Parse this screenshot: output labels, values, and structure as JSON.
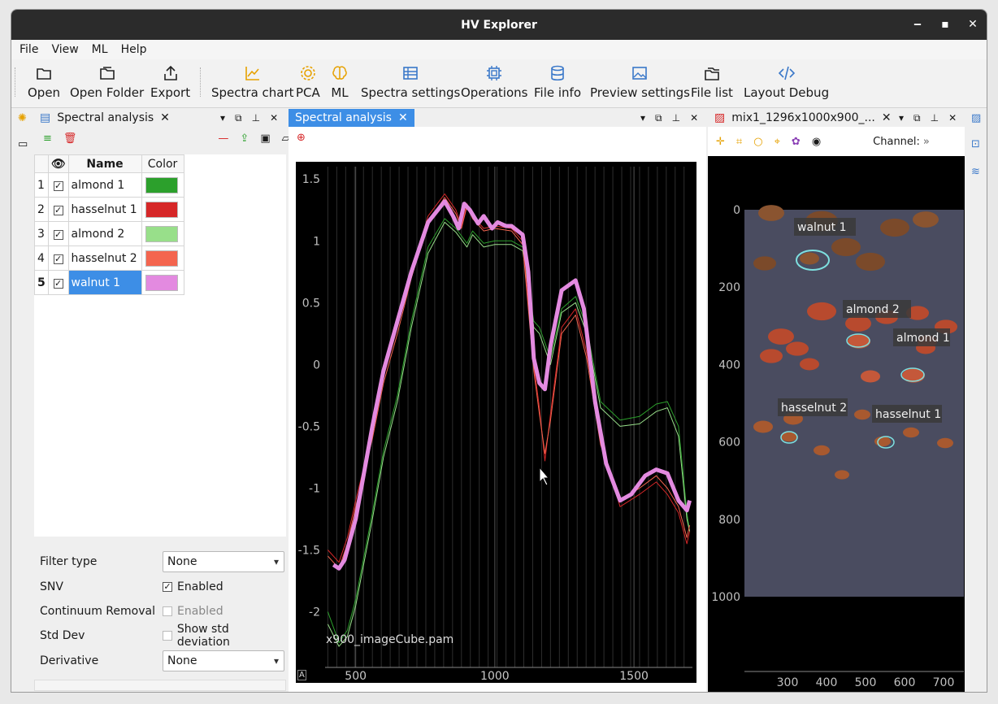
{
  "window": {
    "title": "HV Explorer"
  },
  "menu": [
    "File",
    "View",
    "ML",
    "Help"
  ],
  "toolbar": {
    "open": "Open",
    "open_folder": "Open Folder",
    "export": "Export",
    "spectra_chart": "Spectra chart",
    "pca": "PCA",
    "ml": "ML",
    "spectra_settings": "Spectra settings",
    "operations": "Operations",
    "file_info": "File info",
    "preview_settings": "Preview settings",
    "file_list": "File list",
    "layout_debug": "Layout Debug"
  },
  "left_panel": {
    "tab": "Spectral analysis",
    "columns": {
      "name": "Name",
      "color": "Color"
    },
    "rows": [
      {
        "index": "1",
        "name": "almond 1",
        "color": "#2ca02c"
      },
      {
        "index": "2",
        "name": "hasselnut 1",
        "color": "#d62728"
      },
      {
        "index": "3",
        "name": "almond 2",
        "color": "#98df8a"
      },
      {
        "index": "4",
        "name": "hasselnut 2",
        "color": "#f4654f"
      },
      {
        "index": "5",
        "name": "walnut 1",
        "color": "#e38ae0",
        "selected": true
      }
    ],
    "settings": {
      "filter_type_label": "Filter type",
      "filter_type_value": "None",
      "snv_label": "SNV",
      "snv_check": "Enabled",
      "continuum_label": "Continuum Removal",
      "continuum_check": "Enabled",
      "stddev_label": "Std Dev",
      "stddev_check": "Show std deviation",
      "derivative_label": "Derivative",
      "derivative_value": "None"
    }
  },
  "center_panel": {
    "tab": "Spectral analysis",
    "caption": "x900_imageCube.pam",
    "corner": "A"
  },
  "right_panel": {
    "tab": "mix1_1296x1000x900_...",
    "channel_label": "Channel:",
    "channel_more": "»"
  },
  "chart_data": {
    "type": "line",
    "xlim": [
      390,
      1710
    ],
    "ylim": [
      -2.45,
      1.6
    ],
    "x_ticks": [
      "500",
      "1000",
      "1500"
    ],
    "y_ticks": [
      "1.5",
      "1",
      "0.5",
      "0",
      "-0.5",
      "-1",
      "-1.5",
      "-2"
    ],
    "grid": true,
    "series": [
      {
        "color": "#2ca02c",
        "width": 1,
        "points": [
          [
            400,
            -2.0
          ],
          [
            440,
            -2.25
          ],
          [
            470,
            -2.15
          ],
          [
            500,
            -1.9
          ],
          [
            560,
            -1.2
          ],
          [
            600,
            -0.7
          ],
          [
            650,
            -0.25
          ],
          [
            700,
            0.35
          ],
          [
            760,
            0.95
          ],
          [
            820,
            1.18
          ],
          [
            860,
            1.1
          ],
          [
            900,
            0.98
          ],
          [
            920,
            1.08
          ],
          [
            960,
            0.98
          ],
          [
            1000,
            1.0
          ],
          [
            1060,
            1.0
          ],
          [
            1100,
            0.95
          ],
          [
            1140,
            0.35
          ],
          [
            1160,
            0.3
          ],
          [
            1200,
            0.05
          ],
          [
            1240,
            0.45
          ],
          [
            1290,
            0.55
          ],
          [
            1330,
            0.3
          ],
          [
            1380,
            -0.3
          ],
          [
            1450,
            -0.45
          ],
          [
            1520,
            -0.42
          ],
          [
            1580,
            -0.32
          ],
          [
            1620,
            -0.3
          ],
          [
            1660,
            -0.5
          ],
          [
            1690,
            -1.2
          ],
          [
            1700,
            -1.35
          ]
        ]
      },
      {
        "color": "#98df8a",
        "width": 1,
        "points": [
          [
            400,
            -2.1
          ],
          [
            440,
            -2.28
          ],
          [
            470,
            -2.2
          ],
          [
            500,
            -1.95
          ],
          [
            560,
            -1.25
          ],
          [
            600,
            -0.75
          ],
          [
            650,
            -0.3
          ],
          [
            700,
            0.3
          ],
          [
            760,
            0.9
          ],
          [
            820,
            1.15
          ],
          [
            860,
            1.07
          ],
          [
            900,
            0.95
          ],
          [
            920,
            1.05
          ],
          [
            960,
            0.95
          ],
          [
            1000,
            0.97
          ],
          [
            1060,
            0.97
          ],
          [
            1100,
            0.92
          ],
          [
            1140,
            0.3
          ],
          [
            1160,
            0.25
          ],
          [
            1200,
            0.0
          ],
          [
            1240,
            0.42
          ],
          [
            1290,
            0.5
          ],
          [
            1330,
            0.25
          ],
          [
            1380,
            -0.35
          ],
          [
            1450,
            -0.5
          ],
          [
            1520,
            -0.48
          ],
          [
            1580,
            -0.38
          ],
          [
            1620,
            -0.35
          ],
          [
            1660,
            -0.58
          ],
          [
            1690,
            -1.25
          ],
          [
            1700,
            -1.35
          ]
        ]
      },
      {
        "color": "#d62728",
        "width": 1,
        "points": [
          [
            400,
            -1.5
          ],
          [
            440,
            -1.6
          ],
          [
            470,
            -1.4
          ],
          [
            500,
            -1.1
          ],
          [
            560,
            -0.55
          ],
          [
            600,
            -0.1
          ],
          [
            650,
            0.3
          ],
          [
            700,
            0.75
          ],
          [
            760,
            1.2
          ],
          [
            820,
            1.38
          ],
          [
            860,
            1.25
          ],
          [
            880,
            1.12
          ],
          [
            900,
            1.3
          ],
          [
            920,
            1.2
          ],
          [
            960,
            1.1
          ],
          [
            1000,
            1.12
          ],
          [
            1060,
            1.1
          ],
          [
            1100,
            1.0
          ],
          [
            1140,
            0.0
          ],
          [
            1160,
            -0.35
          ],
          [
            1180,
            -0.78
          ],
          [
            1200,
            -0.4
          ],
          [
            1240,
            0.3
          ],
          [
            1290,
            0.45
          ],
          [
            1330,
            0.1
          ],
          [
            1380,
            -0.6
          ],
          [
            1450,
            -1.15
          ],
          [
            1520,
            -1.05
          ],
          [
            1580,
            -0.95
          ],
          [
            1620,
            -1.05
          ],
          [
            1660,
            -1.2
          ],
          [
            1690,
            -1.45
          ],
          [
            1700,
            -1.35
          ]
        ]
      },
      {
        "color": "#f4654f",
        "width": 1,
        "points": [
          [
            400,
            -1.55
          ],
          [
            440,
            -1.65
          ],
          [
            470,
            -1.45
          ],
          [
            500,
            -1.15
          ],
          [
            560,
            -0.6
          ],
          [
            600,
            -0.15
          ],
          [
            650,
            0.25
          ],
          [
            700,
            0.7
          ],
          [
            760,
            1.15
          ],
          [
            820,
            1.35
          ],
          [
            860,
            1.22
          ],
          [
            880,
            1.1
          ],
          [
            900,
            1.28
          ],
          [
            920,
            1.18
          ],
          [
            960,
            1.08
          ],
          [
            1000,
            1.1
          ],
          [
            1060,
            1.08
          ],
          [
            1100,
            0.97
          ],
          [
            1140,
            -0.05
          ],
          [
            1160,
            -0.4
          ],
          [
            1180,
            -0.72
          ],
          [
            1200,
            -0.45
          ],
          [
            1240,
            0.25
          ],
          [
            1290,
            0.4
          ],
          [
            1330,
            0.05
          ],
          [
            1380,
            -0.65
          ],
          [
            1450,
            -1.1
          ],
          [
            1520,
            -1.0
          ],
          [
            1580,
            -0.9
          ],
          [
            1620,
            -1.0
          ],
          [
            1660,
            -1.15
          ],
          [
            1690,
            -1.4
          ],
          [
            1700,
            -1.3
          ]
        ]
      },
      {
        "color": "#e38ae0",
        "width": 5,
        "points": [
          [
            420,
            -1.62
          ],
          [
            440,
            -1.65
          ],
          [
            460,
            -1.58
          ],
          [
            500,
            -1.25
          ],
          [
            560,
            -0.5
          ],
          [
            600,
            -0.05
          ],
          [
            650,
            0.35
          ],
          [
            700,
            0.75
          ],
          [
            760,
            1.15
          ],
          [
            820,
            1.32
          ],
          [
            850,
            1.2
          ],
          [
            870,
            1.1
          ],
          [
            890,
            1.3
          ],
          [
            910,
            1.25
          ],
          [
            940,
            1.14
          ],
          [
            960,
            1.2
          ],
          [
            990,
            1.1
          ],
          [
            1010,
            1.15
          ],
          [
            1040,
            1.12
          ],
          [
            1060,
            1.12
          ],
          [
            1100,
            1.05
          ],
          [
            1120,
            0.75
          ],
          [
            1140,
            0.05
          ],
          [
            1160,
            -0.15
          ],
          [
            1180,
            -0.2
          ],
          [
            1200,
            0.15
          ],
          [
            1240,
            0.6
          ],
          [
            1290,
            0.68
          ],
          [
            1320,
            0.45
          ],
          [
            1360,
            -0.3
          ],
          [
            1400,
            -0.8
          ],
          [
            1450,
            -1.1
          ],
          [
            1490,
            -1.05
          ],
          [
            1540,
            -0.9
          ],
          [
            1580,
            -0.85
          ],
          [
            1620,
            -0.88
          ],
          [
            1660,
            -1.1
          ],
          [
            1690,
            -1.18
          ],
          [
            1700,
            -1.1
          ]
        ]
      }
    ]
  },
  "image_view": {
    "y_ticks": [
      "0",
      "200",
      "400",
      "600",
      "800",
      "1000"
    ],
    "x_ticks": [
      "300",
      "400",
      "500",
      "600",
      "700"
    ],
    "labels": [
      {
        "text": "walnut 1"
      },
      {
        "text": "almond 2"
      },
      {
        "text": "almond 1"
      },
      {
        "text": "hasselnut 2"
      },
      {
        "text": "hasselnut 1"
      }
    ]
  }
}
